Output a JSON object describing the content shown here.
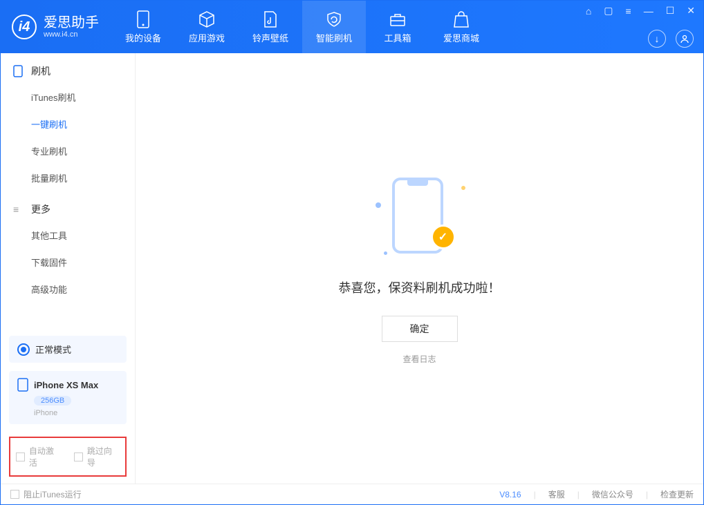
{
  "brand": {
    "name": "爱思助手",
    "sub": "www.i4.cn"
  },
  "nav": {
    "items": [
      {
        "label": "我的设备"
      },
      {
        "label": "应用游戏"
      },
      {
        "label": "铃声壁纸"
      },
      {
        "label": "智能刷机"
      },
      {
        "label": "工具箱"
      },
      {
        "label": "爱思商城"
      }
    ]
  },
  "sidebar": {
    "section_flash": "刷机",
    "flash_items": [
      "iTunes刷机",
      "一键刷机",
      "专业刷机",
      "批量刷机"
    ],
    "section_more": "更多",
    "more_items": [
      "其他工具",
      "下载固件",
      "高级功能"
    ]
  },
  "mode": {
    "label": "正常模式"
  },
  "device": {
    "name": "iPhone XS Max",
    "storage": "256GB",
    "type": "iPhone"
  },
  "options": {
    "auto_activate": "自动激活",
    "skip_guide": "跳过向导"
  },
  "footer": {
    "block_itunes": "阻止iTunes运行",
    "version": "V8.16",
    "service": "客服",
    "wechat": "微信公众号",
    "update": "检查更新"
  },
  "main": {
    "success": "恭喜您，保资料刷机成功啦！",
    "ok": "确定",
    "view_log": "查看日志"
  }
}
